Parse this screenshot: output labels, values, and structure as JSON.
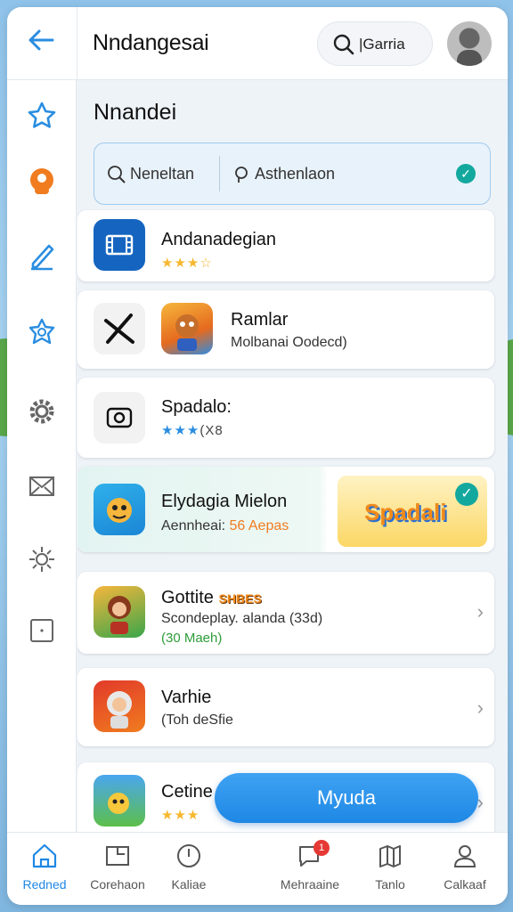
{
  "header": {
    "title": "Nndangesai",
    "search_label": "|Garria"
  },
  "section": {
    "title": "Nnandei"
  },
  "filters": {
    "left_label": "Neneltan",
    "right_label": "Asthenlaon"
  },
  "apps": [
    {
      "title": "Andanadegian",
      "rating": "★★★☆",
      "subtitle": ""
    },
    {
      "title": "Ramlar",
      "subtitle": "Molbanai Oodecd)"
    },
    {
      "title": "Spadalo:",
      "rating": "★★★",
      "rating_text": "(X8"
    },
    {
      "title": "Elydagia Mielon",
      "subtitle_prefix": "Aennheai:",
      "subtitle_value": "56 Aepas",
      "banner_text": "Spadali"
    },
    {
      "title": "Gottite",
      "title_badge": "SHBES",
      "subtitle": "Scondeplay. alanda (33d)",
      "note": "(30 Maeh)"
    },
    {
      "title": "Varhie",
      "subtitle": "(Toh deSfie"
    },
    {
      "title": "Cetine",
      "rating": "★★★"
    }
  ],
  "fab": {
    "label": "Myuda"
  },
  "tabs": [
    {
      "label": "Redned"
    },
    {
      "label": "Corehaon"
    },
    {
      "label": "Kaliae"
    },
    {
      "label": "Mehraaine",
      "badge": "1"
    },
    {
      "label": "Tanlo"
    },
    {
      "label": "Calkaaf"
    }
  ],
  "colors": {
    "accent": "#1e88e5",
    "star": "#f5b82e",
    "star_blue": "#2a8de0",
    "success": "#13a89e",
    "orange": "#f07c1f"
  }
}
